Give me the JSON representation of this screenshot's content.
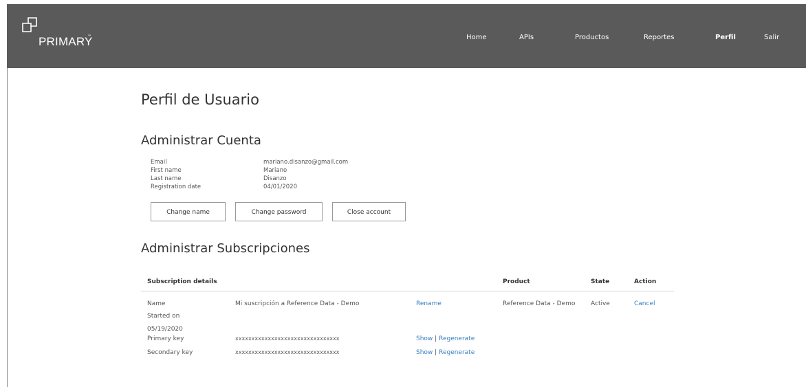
{
  "brand": {
    "name": "PRIMARY",
    "tm": "™"
  },
  "nav": [
    {
      "label": "Home"
    },
    {
      "label": "APIs"
    },
    {
      "label": "Productos"
    },
    {
      "label": "Reportes"
    },
    {
      "label": "Perfil"
    },
    {
      "label": "Salir"
    }
  ],
  "page": {
    "title": "Perfil de Usuario"
  },
  "account": {
    "heading": "Administrar Cuenta",
    "fields": [
      {
        "label": "Email",
        "value": "mariano.disanzo@gmail.com"
      },
      {
        "label": "First name",
        "value": "Mariano"
      },
      {
        "label": "Last name",
        "value": "Disanzo"
      },
      {
        "label": "Registration date",
        "value": "04/01/2020"
      }
    ],
    "buttons": {
      "change_name": "Change name",
      "change_password": "Change password",
      "close_account": "Close account"
    }
  },
  "subscriptions": {
    "heading": "Administrar Subscripciones",
    "columns": {
      "details": "Subscription details",
      "product": "Product",
      "state": "State",
      "action": "Action"
    },
    "row": {
      "name_label": "Name",
      "name_value": "Mi suscripción a Reference Data - Demo",
      "rename": "Rename",
      "product": "Reference Data - Demo",
      "state": "Active",
      "cancel": "Cancel",
      "started_label": "Started on",
      "started_value": "05/19/2020",
      "primary_label": "Primary key",
      "primary_value": "xxxxxxxxxxxxxxxxxxxxxxxxxxxxxxxx",
      "secondary_label": "Secondary key",
      "secondary_value": "xxxxxxxxxxxxxxxxxxxxxxxxxxxxxxxx",
      "show": "Show",
      "separator": "|",
      "regenerate": "Regenerate"
    }
  },
  "colors": {
    "topbar": "#5a5a5a",
    "link": "#3a7fc1"
  }
}
